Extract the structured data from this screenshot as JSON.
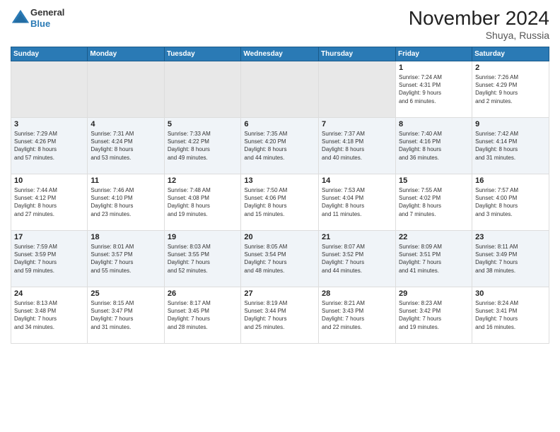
{
  "header": {
    "logo_general": "General",
    "logo_blue": "Blue",
    "month_title": "November 2024",
    "location": "Shuya, Russia"
  },
  "weekdays": [
    "Sunday",
    "Monday",
    "Tuesday",
    "Wednesday",
    "Thursday",
    "Friday",
    "Saturday"
  ],
  "weeks": [
    [
      {
        "day": "",
        "info": ""
      },
      {
        "day": "",
        "info": ""
      },
      {
        "day": "",
        "info": ""
      },
      {
        "day": "",
        "info": ""
      },
      {
        "day": "",
        "info": ""
      },
      {
        "day": "1",
        "info": "Sunrise: 7:24 AM\nSunset: 4:31 PM\nDaylight: 9 hours\nand 6 minutes."
      },
      {
        "day": "2",
        "info": "Sunrise: 7:26 AM\nSunset: 4:29 PM\nDaylight: 9 hours\nand 2 minutes."
      }
    ],
    [
      {
        "day": "3",
        "info": "Sunrise: 7:29 AM\nSunset: 4:26 PM\nDaylight: 8 hours\nand 57 minutes."
      },
      {
        "day": "4",
        "info": "Sunrise: 7:31 AM\nSunset: 4:24 PM\nDaylight: 8 hours\nand 53 minutes."
      },
      {
        "day": "5",
        "info": "Sunrise: 7:33 AM\nSunset: 4:22 PM\nDaylight: 8 hours\nand 49 minutes."
      },
      {
        "day": "6",
        "info": "Sunrise: 7:35 AM\nSunset: 4:20 PM\nDaylight: 8 hours\nand 44 minutes."
      },
      {
        "day": "7",
        "info": "Sunrise: 7:37 AM\nSunset: 4:18 PM\nDaylight: 8 hours\nand 40 minutes."
      },
      {
        "day": "8",
        "info": "Sunrise: 7:40 AM\nSunset: 4:16 PM\nDaylight: 8 hours\nand 36 minutes."
      },
      {
        "day": "9",
        "info": "Sunrise: 7:42 AM\nSunset: 4:14 PM\nDaylight: 8 hours\nand 31 minutes."
      }
    ],
    [
      {
        "day": "10",
        "info": "Sunrise: 7:44 AM\nSunset: 4:12 PM\nDaylight: 8 hours\nand 27 minutes."
      },
      {
        "day": "11",
        "info": "Sunrise: 7:46 AM\nSunset: 4:10 PM\nDaylight: 8 hours\nand 23 minutes."
      },
      {
        "day": "12",
        "info": "Sunrise: 7:48 AM\nSunset: 4:08 PM\nDaylight: 8 hours\nand 19 minutes."
      },
      {
        "day": "13",
        "info": "Sunrise: 7:50 AM\nSunset: 4:06 PM\nDaylight: 8 hours\nand 15 minutes."
      },
      {
        "day": "14",
        "info": "Sunrise: 7:53 AM\nSunset: 4:04 PM\nDaylight: 8 hours\nand 11 minutes."
      },
      {
        "day": "15",
        "info": "Sunrise: 7:55 AM\nSunset: 4:02 PM\nDaylight: 8 hours\nand 7 minutes."
      },
      {
        "day": "16",
        "info": "Sunrise: 7:57 AM\nSunset: 4:00 PM\nDaylight: 8 hours\nand 3 minutes."
      }
    ],
    [
      {
        "day": "17",
        "info": "Sunrise: 7:59 AM\nSunset: 3:59 PM\nDaylight: 7 hours\nand 59 minutes."
      },
      {
        "day": "18",
        "info": "Sunrise: 8:01 AM\nSunset: 3:57 PM\nDaylight: 7 hours\nand 55 minutes."
      },
      {
        "day": "19",
        "info": "Sunrise: 8:03 AM\nSunset: 3:55 PM\nDaylight: 7 hours\nand 52 minutes."
      },
      {
        "day": "20",
        "info": "Sunrise: 8:05 AM\nSunset: 3:54 PM\nDaylight: 7 hours\nand 48 minutes."
      },
      {
        "day": "21",
        "info": "Sunrise: 8:07 AM\nSunset: 3:52 PM\nDaylight: 7 hours\nand 44 minutes."
      },
      {
        "day": "22",
        "info": "Sunrise: 8:09 AM\nSunset: 3:51 PM\nDaylight: 7 hours\nand 41 minutes."
      },
      {
        "day": "23",
        "info": "Sunrise: 8:11 AM\nSunset: 3:49 PM\nDaylight: 7 hours\nand 38 minutes."
      }
    ],
    [
      {
        "day": "24",
        "info": "Sunrise: 8:13 AM\nSunset: 3:48 PM\nDaylight: 7 hours\nand 34 minutes."
      },
      {
        "day": "25",
        "info": "Sunrise: 8:15 AM\nSunset: 3:47 PM\nDaylight: 7 hours\nand 31 minutes."
      },
      {
        "day": "26",
        "info": "Sunrise: 8:17 AM\nSunset: 3:45 PM\nDaylight: 7 hours\nand 28 minutes."
      },
      {
        "day": "27",
        "info": "Sunrise: 8:19 AM\nSunset: 3:44 PM\nDaylight: 7 hours\nand 25 minutes."
      },
      {
        "day": "28",
        "info": "Sunrise: 8:21 AM\nSunset: 3:43 PM\nDaylight: 7 hours\nand 22 minutes."
      },
      {
        "day": "29",
        "info": "Sunrise: 8:23 AM\nSunset: 3:42 PM\nDaylight: 7 hours\nand 19 minutes."
      },
      {
        "day": "30",
        "info": "Sunrise: 8:24 AM\nSunset: 3:41 PM\nDaylight: 7 hours\nand 16 minutes."
      }
    ]
  ],
  "colors": {
    "header_bg": "#2a7ab5",
    "empty_cell": "#e8e8e8",
    "row_even": "#f0f4f8",
    "row_odd": "#ffffff"
  }
}
